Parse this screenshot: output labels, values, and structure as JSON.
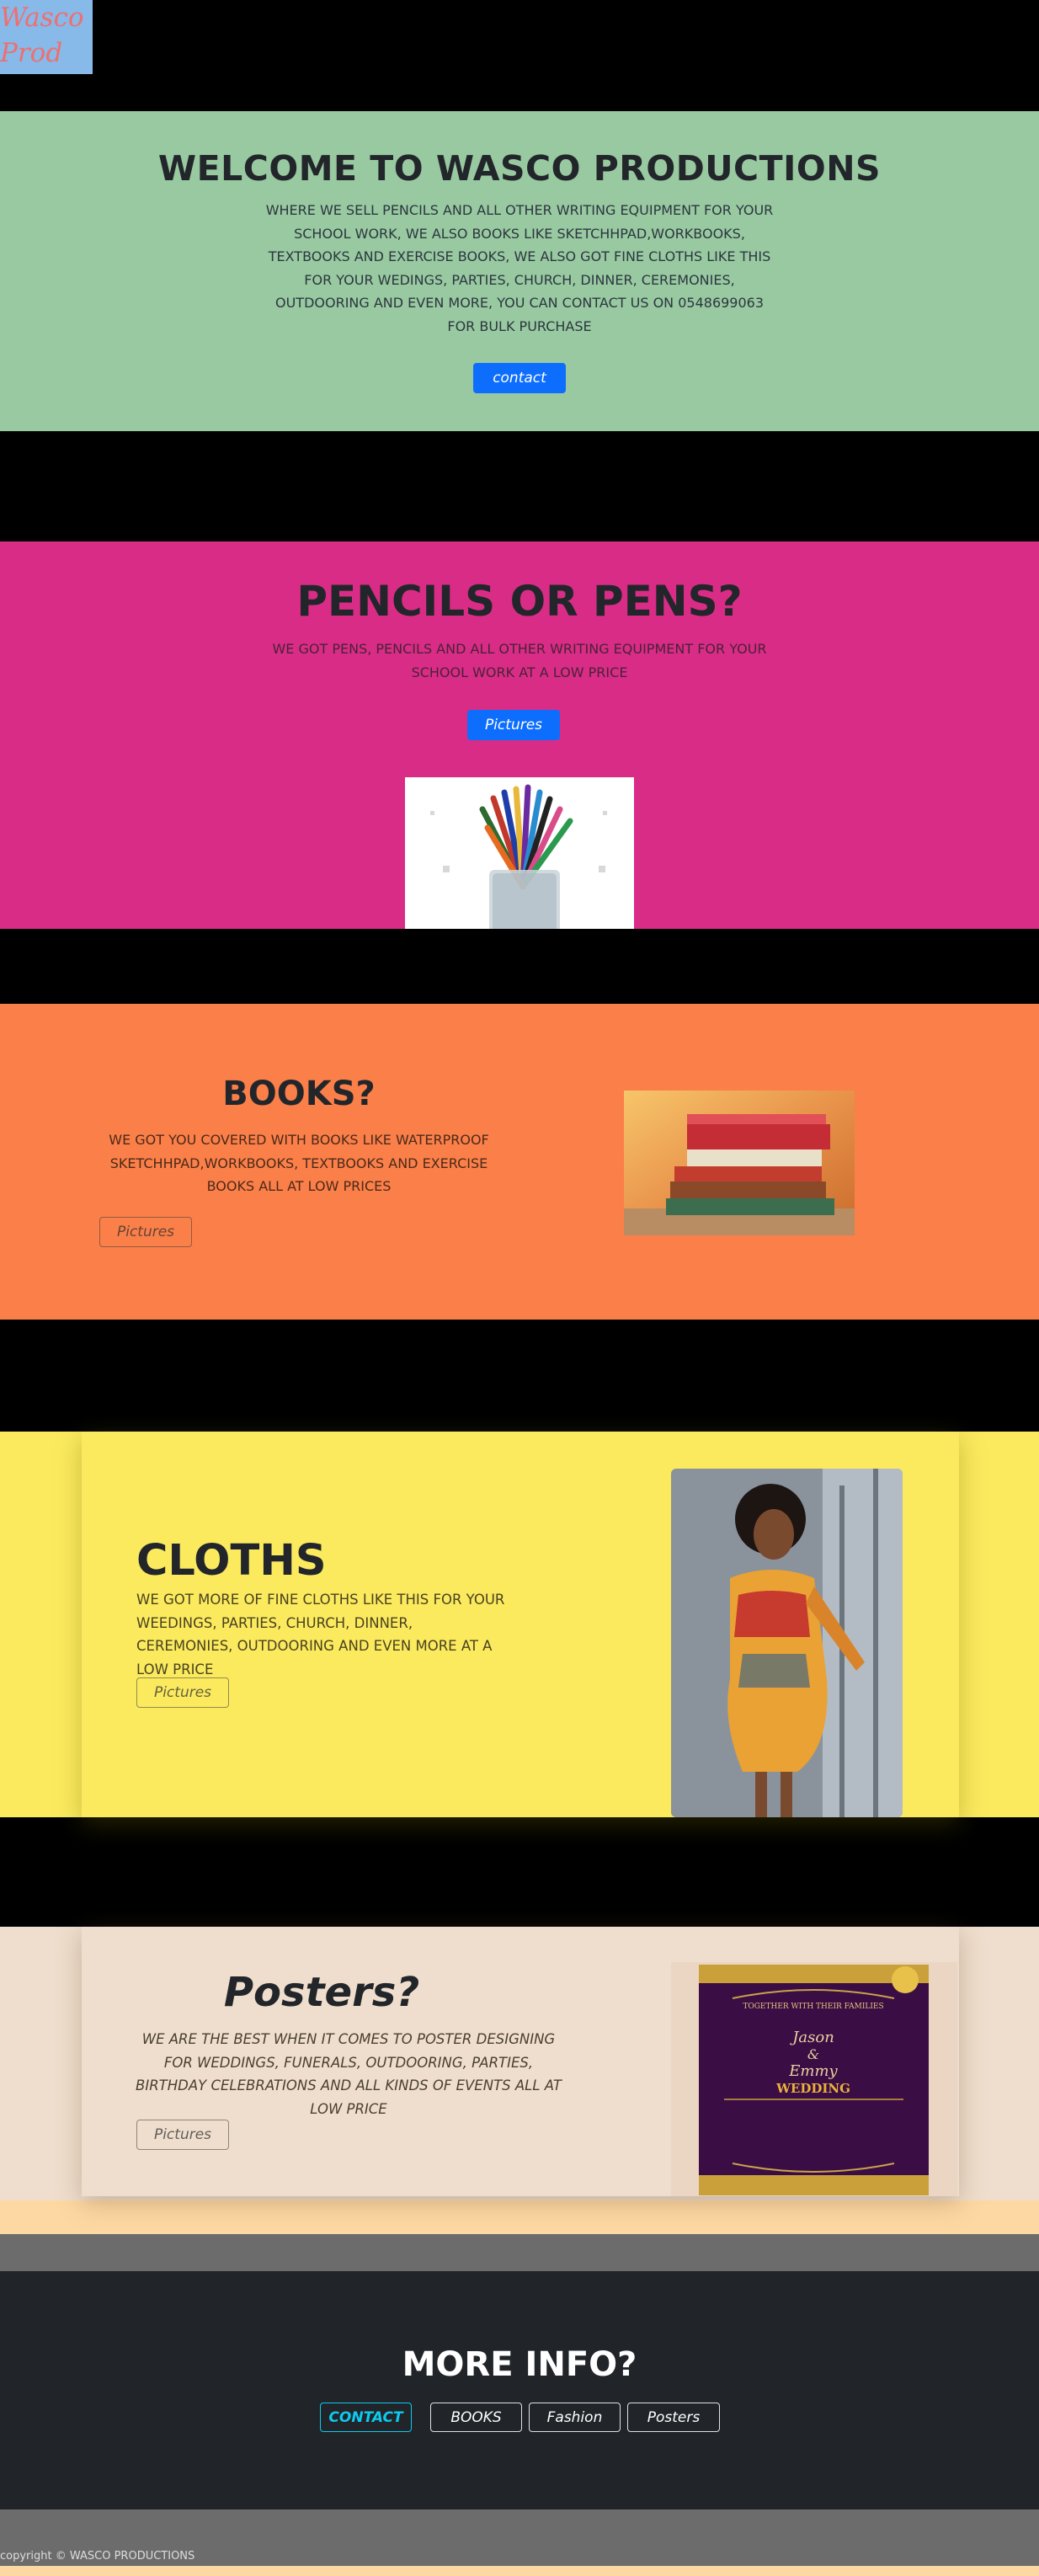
{
  "logo": {
    "line1": "Wasco",
    "line2": "Prod"
  },
  "welcome": {
    "title": "WELCOME TO WASCO PRODUCTIONS",
    "text": "WHERE WE SELL PENCILS AND ALL OTHER WRITING EQUIPMENT FOR YOUR SCHOOL WORK, WE ALSO BOOKS LIKE SKETCHHPAD,WORKBOOKS, TEXTBOOKS AND EXERCISE BOOKS, WE ALSO GOT FINE CLOTHS LIKE THIS FOR YOUR WEDINGS, PARTIES, CHURCH, DINNER, CEREMONIES, OUTDOORING AND EVEN MORE, YOU CAN CONTACT US ON 0548699063 FOR BULK PURCHASE",
    "button": "contact"
  },
  "pencils": {
    "title": "PENCILS OR PENS?",
    "text": "WE GOT PENS, PENCILS AND ALL OTHER WRITING EQUIPMENT FOR YOUR SCHOOL WORK AT A LOW PRICE",
    "button": "Pictures"
  },
  "books": {
    "title": "BOOKS?",
    "text": "WE GOT YOU COVERED WITH BOOKS LIKE WATERPROOF SKETCHHPAD,WORKBOOKS, TEXTBOOKS AND EXERCISE BOOKS ALL AT LOW PRICES",
    "button": "Pictures"
  },
  "cloths": {
    "title": "CLOTHS",
    "text": "WE GOT MORE OF FINE CLOTHS LIKE THIS FOR YOUR WEEDINGS, PARTIES, CHURCH, DINNER, CEREMONIES, OUTDOORING AND EVEN MORE AT A LOW PRICE",
    "button": "Pictures"
  },
  "posters": {
    "title": "Posters?",
    "text": "WE ARE THE BEST WHEN IT COMES TO POSTER DESIGNING FOR WEDDINGS, FUNERALS, OUTDOORING, PARTIES, BIRTHDAY CELEBRATIONS AND ALL KINDS OF EVENTS ALL AT LOW PRICE",
    "button": "Pictures",
    "poster": {
      "line1": "TOGETHER WITH THEIR FAMILIES",
      "name1": "Jason",
      "amp": "&",
      "name2": "Emmy",
      "label": "WEDDING"
    }
  },
  "more_info": {
    "title": "MORE INFO?",
    "buttons": [
      "CONTACT",
      "BOOKS",
      "Fashion",
      "Posters"
    ]
  },
  "footer": {
    "copyright": "copyright © WASCO PRODUCTIONS"
  },
  "colors": {
    "welcome_bg": "#98c9a0",
    "pencils_bg": "#d92c86",
    "books_bg": "#fb7f48",
    "cloths_bg": "#fbea5e",
    "posters_bg": "#efdecd",
    "more_info_bg": "#212529",
    "primary_button": "#0d6efd",
    "contact_accent": "#0dcaf0"
  }
}
